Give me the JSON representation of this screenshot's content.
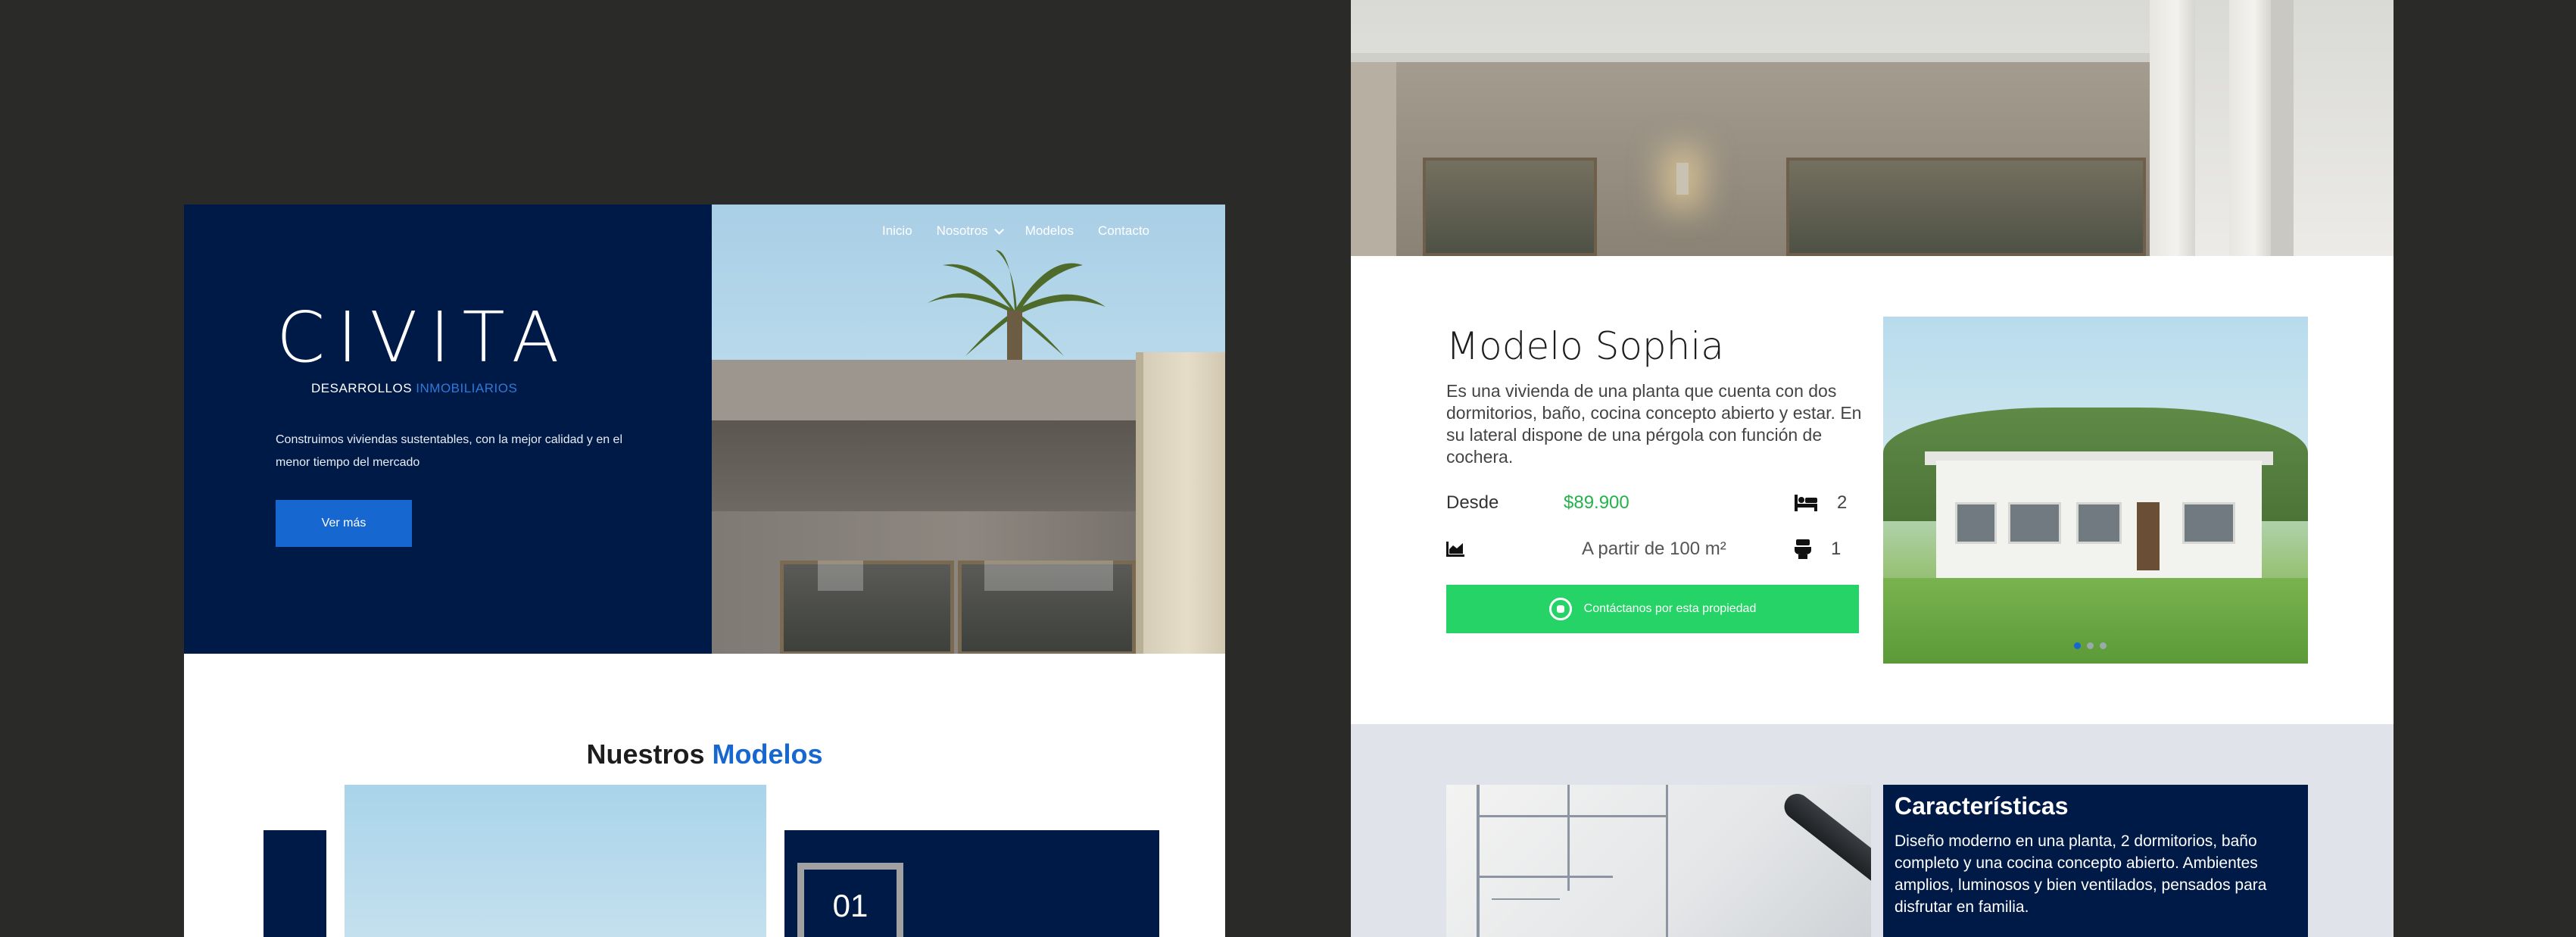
{
  "left_page": {
    "nav": {
      "items": [
        "Inicio",
        "Nosotros",
        "Modelos",
        "Contacto"
      ]
    },
    "logo": {
      "wordmark": "CIVITA",
      "subtitle_part1": "DESARROLLOS",
      "subtitle_part2": "INMOBILIARIOS"
    },
    "hero": {
      "description": "Construimos viviendas sustentables, con la mejor calidad y en el menor tiempo del mercado",
      "cta_label": "Ver más"
    },
    "models_section": {
      "title_part1": "Nuestros",
      "title_part2": "Modelos",
      "card_number": "01"
    }
  },
  "right_page": {
    "model": {
      "name": "Modelo Sophia",
      "description": "Es una vivienda de una planta que cuenta con dos dormitorios, baño, cocina concepto abierto y estar. En su lateral dispone de una pérgola con función de cochera.",
      "price_label": "Desde",
      "price": "$89.900",
      "area": "A partir de 100 m²",
      "bedrooms": "2",
      "bathrooms": "1",
      "whatsapp_label": "Contáctanos por esta propiedad"
    },
    "carousel": {
      "dot_count": 3,
      "active_index": 0
    },
    "features": {
      "title": "Características",
      "text": "Diseño moderno en una planta, 2 dormitorios, baño completo y una cocina concepto abierto. Ambientes amplios, luminosos y bien ventilados, pensados para disfrutar en familia."
    }
  },
  "colors": {
    "background": "#2a2b28",
    "navy": "#001a47",
    "accent_blue": "#1767d1",
    "price_green": "#24b24a",
    "whatsapp_green": "#25d366",
    "section_gray": "#e1e3ea"
  },
  "icons": [
    "chevron-down-icon",
    "bed-icon",
    "area-icon",
    "toilet-icon",
    "whatsapp-icon"
  ]
}
